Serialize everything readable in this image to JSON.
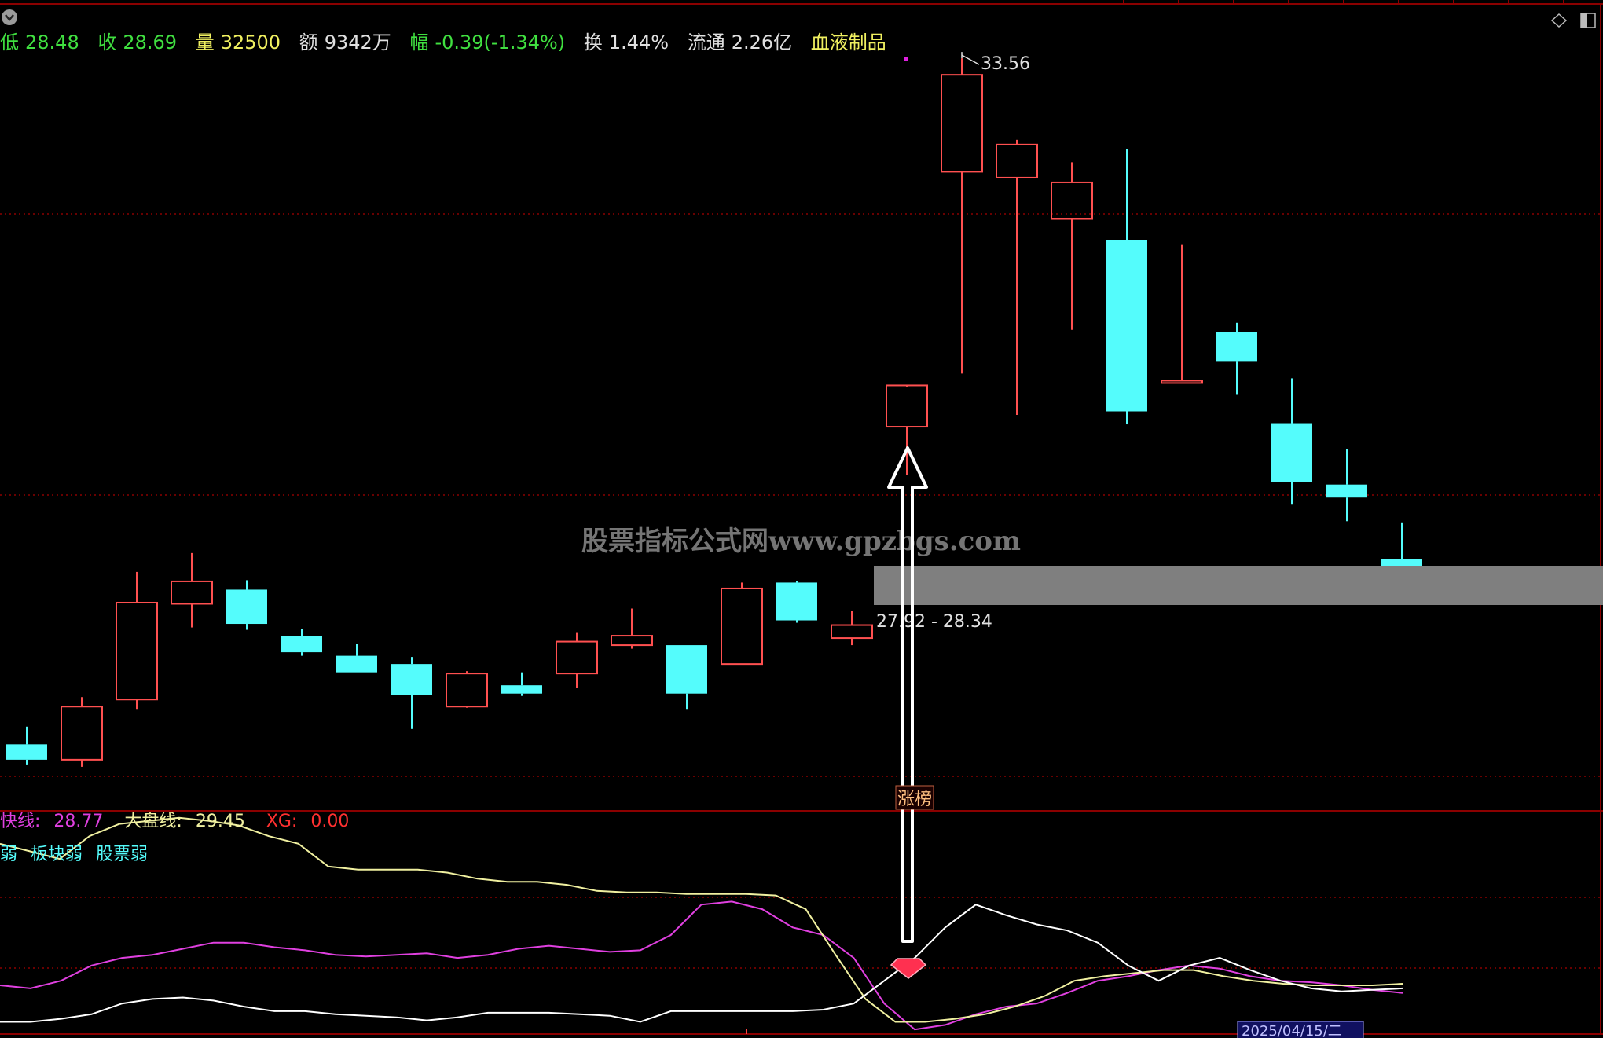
{
  "header": {
    "low": {
      "label": "低",
      "value": "28.48"
    },
    "close": {
      "label": "收",
      "value": "28.69"
    },
    "volume": {
      "label": "量",
      "value": "32500"
    },
    "amount": {
      "label": "额",
      "value": "9342万"
    },
    "change": {
      "label": "幅",
      "value": "-0.39(-1.34%)"
    },
    "turnover": {
      "label": "换",
      "value": "1.44%"
    },
    "float": {
      "label": "流通",
      "value": "2.26亿"
    },
    "sector": "血液制品"
  },
  "watermark": "股票指标公式网www.gpzbgs.com",
  "annotations": {
    "high_label": "33.56",
    "range_label": "27.92 - 28.34",
    "event_label": "涨榜",
    "date_label": "2025/04/15/二"
  },
  "indicator": {
    "fast_line": {
      "label": "快线:",
      "value": "28.77"
    },
    "market_line": {
      "label": "大盘线:",
      "value": "29.45"
    },
    "xg": {
      "label": "XG:",
      "value": "0.00"
    },
    "tags": [
      "弱",
      "板块弱",
      "股票弱"
    ]
  },
  "colors": {
    "up": "#ff5050",
    "down": "#54fcfc",
    "grid": "#8b0000",
    "fast": "#e040e0",
    "market": "#f0f0a0",
    "white_line": "#ffffff",
    "header_green": "#40e040",
    "header_yellow": "#f0f060"
  },
  "chart_data": {
    "type": "candlestick",
    "series": [
      {
        "name": "K线",
        "candles": [
          {
            "o": 27.75,
            "h": 27.9,
            "c": 27.62,
            "l": 27.58
          },
          {
            "o": 27.62,
            "h": 28.15,
            "c": 28.07,
            "l": 27.56
          },
          {
            "o": 28.13,
            "h": 29.21,
            "c": 28.95,
            "l": 28.05
          },
          {
            "o": 28.94,
            "h": 29.37,
            "c": 29.13,
            "l": 28.74
          },
          {
            "o": 29.06,
            "h": 29.14,
            "c": 28.77,
            "l": 28.72
          },
          {
            "o": 28.67,
            "h": 28.73,
            "c": 28.53,
            "l": 28.5
          },
          {
            "o": 28.5,
            "h": 28.6,
            "c": 28.36,
            "l": 28.36
          },
          {
            "o": 28.43,
            "h": 28.49,
            "c": 28.17,
            "l": 27.88
          },
          {
            "o": 28.07,
            "h": 28.37,
            "c": 28.35,
            "l": 28.06
          },
          {
            "o": 28.25,
            "h": 28.36,
            "c": 28.18,
            "l": 28.16
          },
          {
            "o": 28.35,
            "h": 28.7,
            "c": 28.62,
            "l": 28.23
          },
          {
            "o": 28.59,
            "h": 28.9,
            "c": 28.67,
            "l": 28.56
          },
          {
            "o": 28.59,
            "h": 28.59,
            "c": 28.18,
            "l": 28.05
          },
          {
            "o": 28.43,
            "h": 29.12,
            "c": 29.07,
            "l": 28.43
          },
          {
            "o": 29.12,
            "h": 29.13,
            "c": 28.8,
            "l": 28.78
          },
          {
            "o": 28.65,
            "h": 28.88,
            "c": 28.76,
            "l": 28.59
          },
          {
            "o": 30.44,
            "h": 30.78,
            "c": 30.79,
            "l": 30.03
          },
          {
            "o": 32.6,
            "h": 33.56,
            "c": 33.42,
            "l": 30.89
          },
          {
            "o": 32.55,
            "h": 32.87,
            "c": 32.83,
            "l": 30.54
          },
          {
            "o": 32.2,
            "h": 32.68,
            "c": 32.51,
            "l": 31.26
          },
          {
            "o": 32.02,
            "h": 32.79,
            "c": 30.57,
            "l": 30.46
          },
          {
            "o": 30.82,
            "h": 31.98,
            "c": 30.83,
            "l": 30.82
          },
          {
            "o": 31.24,
            "h": 31.32,
            "c": 30.99,
            "l": 30.71
          },
          {
            "o": 30.47,
            "h": 30.85,
            "c": 29.97,
            "l": 29.78
          },
          {
            "o": 29.95,
            "h": 30.25,
            "c": 29.84,
            "l": 29.64
          },
          {
            "o": 29.32,
            "h": 29.63,
            "c": 29.25,
            "l": 29.13
          }
        ]
      }
    ],
    "indicator_series": [
      {
        "name": "快线",
        "values": [
          29.02,
          29.0,
          29.05,
          29.15,
          29.2,
          29.22,
          29.26,
          29.3,
          29.3,
          29.27,
          29.25,
          29.22,
          29.21,
          29.22,
          29.23,
          29.2,
          29.22,
          29.26,
          29.28,
          29.26,
          29.24,
          29.25,
          29.35,
          29.55,
          29.57,
          29.52,
          29.4,
          29.35,
          29.2,
          28.9,
          28.73,
          28.76,
          28.83,
          28.88,
          28.9,
          28.97,
          29.05,
          29.08,
          29.12,
          29.15,
          29.13,
          29.08,
          29.05,
          29.04,
          29.02,
          28.99,
          28.97
        ]
      },
      {
        "name": "大盘线",
        "values": [
          29.95,
          29.9,
          29.85,
          30.0,
          30.08,
          30.1,
          30.12,
          30.1,
          30.07,
          30.0,
          29.95,
          29.8,
          29.78,
          29.78,
          29.78,
          29.76,
          29.72,
          29.7,
          29.7,
          29.68,
          29.64,
          29.63,
          29.63,
          29.62,
          29.62,
          29.62,
          29.61,
          29.52,
          29.22,
          28.93,
          28.78,
          28.78,
          28.8,
          28.83,
          28.88,
          28.95,
          29.05,
          29.08,
          29.1,
          29.12,
          29.12,
          29.08,
          29.05,
          29.03,
          29.02,
          29.02,
          29.02,
          29.03
        ]
      },
      {
        "name": "白线",
        "values": [
          28.78,
          28.78,
          28.8,
          28.83,
          28.9,
          28.93,
          28.94,
          28.92,
          28.88,
          28.85,
          28.85,
          28.83,
          28.82,
          28.81,
          28.79,
          28.81,
          28.84,
          28.84,
          28.84,
          28.83,
          28.82,
          28.78,
          28.85,
          28.85,
          28.85,
          28.85,
          28.85,
          28.86,
          28.9,
          29.05,
          29.2,
          29.4,
          29.55,
          29.48,
          29.42,
          29.38,
          29.3,
          29.15,
          29.05,
          29.15,
          29.2,
          29.12,
          29.05,
          29.0,
          28.98,
          28.99,
          29.0
        ]
      }
    ],
    "price_range": [
      27.2,
      34.0
    ],
    "indicator_range": [
      28.7,
      30.15
    ]
  }
}
